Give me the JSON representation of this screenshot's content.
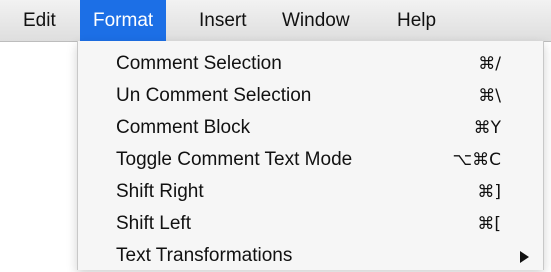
{
  "menubar": {
    "items": [
      {
        "label": "Edit"
      },
      {
        "label": "Format",
        "active": true
      },
      {
        "label": "Insert"
      },
      {
        "label": "Window"
      },
      {
        "label": "Help"
      }
    ]
  },
  "format_menu": {
    "items": [
      {
        "label": "Comment Selection",
        "shortcut": "⌘/"
      },
      {
        "label": "Un Comment Selection",
        "shortcut": "⌘\\"
      },
      {
        "label": "Comment Block",
        "shortcut": "⌘Y"
      },
      {
        "label": "Toggle Comment Text Mode",
        "shortcut": "⌥⌘C"
      },
      {
        "label": "Shift Right",
        "shortcut": "⌘]"
      },
      {
        "label": "Shift Left",
        "shortcut": "⌘["
      },
      {
        "label": "Text Transformations",
        "submenu": true
      }
    ]
  },
  "colors": {
    "highlight": "#1c6fe6",
    "menu_background": "#f6f6f6",
    "menubar_background": "#e6e6e6"
  },
  "icons": {
    "submenu_indicator": "submenu-arrow-icon"
  }
}
